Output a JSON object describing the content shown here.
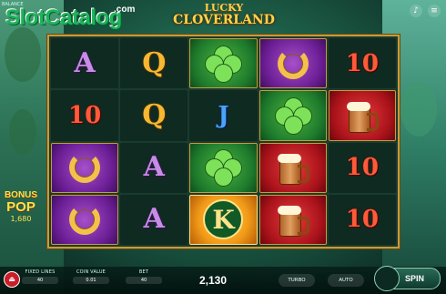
{
  "header": {
    "balance_label": "BALANCE",
    "watermark": "SlotCatalog",
    "watermark_domain": ".com",
    "logo_line1": "LUCKY",
    "logo_line2": "CLOVERLAND",
    "top_icons": [
      "sound-icon",
      "menu-icon"
    ]
  },
  "reels": [
    [
      "A",
      "10",
      "horseshoe",
      "horseshoe"
    ],
    [
      "Q",
      "Q",
      "A",
      "A"
    ],
    [
      "clover",
      "J",
      "clover",
      "K"
    ],
    [
      "horseshoe",
      "clover",
      "mug",
      "mug"
    ],
    [
      "10",
      "mug",
      "10",
      "10"
    ]
  ],
  "bonus": {
    "line1": "BONUS",
    "line2": "POP",
    "value": "1,680"
  },
  "bottom_bar": {
    "fixed_lines_label": "FIXED LINES",
    "fixed_lines_value": "40",
    "coin_value_label": "COIN VALUE",
    "coin_value_value": "0.01",
    "bet_label": "BET",
    "bet_value": "40",
    "win_value": "2,130",
    "turbo_label": "TURBO",
    "auto_label": "AUTO",
    "spin_label": "SPIN"
  },
  "colors": {
    "frame_gold": "#c89b3a",
    "accent_red": "#c81e2a"
  }
}
